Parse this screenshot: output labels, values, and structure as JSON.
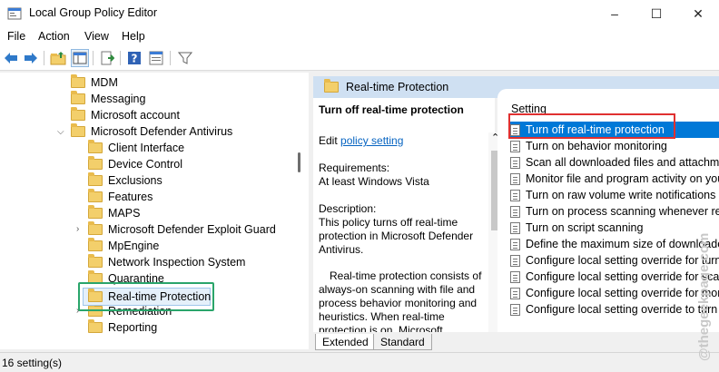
{
  "window": {
    "title": "Local Group Policy Editor",
    "icon": "gpedit-icon",
    "controls": {
      "minimize": "–",
      "maximize": "☐",
      "close": "✕"
    }
  },
  "menu": [
    "File",
    "Action",
    "View",
    "Help"
  ],
  "toolbar": {
    "icons": [
      "back-icon",
      "forward-icon",
      "up-folder-icon",
      "show-hide-tree-icon",
      "export-list-icon",
      "help-icon",
      "properties-icon",
      "filter-icon"
    ]
  },
  "tree": {
    "items": [
      {
        "label": "MDM"
      },
      {
        "label": "Messaging"
      },
      {
        "label": "Microsoft account"
      },
      {
        "label": "Microsoft Defender Antivirus",
        "expanded": true
      },
      {
        "label": "Client Interface"
      },
      {
        "label": "Device Control"
      },
      {
        "label": "Exclusions"
      },
      {
        "label": "Features"
      },
      {
        "label": "MAPS"
      },
      {
        "label": "Microsoft Defender Exploit Guard",
        "collapsed": true
      },
      {
        "label": "MpEngine"
      },
      {
        "label": "Network Inspection System"
      },
      {
        "label": "Quarantine"
      },
      {
        "label": "Real-time Protection",
        "selected": true
      },
      {
        "label": "Remediation",
        "collapsed": true
      },
      {
        "label": "Reporting"
      }
    ]
  },
  "details": {
    "header": "Real-time Protection",
    "policy_title": "Turn off real-time protection",
    "edit_prefix": "Edit",
    "edit_link": "policy setting",
    "requirements_label": "Requirements:",
    "requirements_value": "At least Windows Vista",
    "description_label": "Description:",
    "description_1": "This policy turns off real-time protection in Microsoft Defender Antivirus.",
    "description_2": "Real-time protection consists of always-on scanning with file and process behavior monitoring and heuristics. When real-time protection is on, Microsoft"
  },
  "list": {
    "column": "Setting",
    "rows": [
      "Turn off real-time protection",
      "Turn on behavior monitoring",
      "Scan all downloaded files and attachments",
      "Monitor file and program activity on your computer",
      "Turn on raw volume write notifications",
      "Turn on process scanning whenever real-time protection is enabled",
      "Turn on script scanning",
      "Define the maximum size of downloaded files and attachments to be scanned",
      "Configure local setting override for turn on behavior monitoring",
      "Configure local setting override for scanning all downloaded files",
      "Configure local setting override for monitoring file and program activity",
      "Configure local setting override to turn on real-time protection"
    ],
    "selected_index": 0
  },
  "tabs": [
    "Extended",
    "Standard"
  ],
  "status": "16 setting(s)",
  "watermark": "@thegeekpage.com",
  "colors": {
    "selection": "#0078d7",
    "highlight_red": "#e03030",
    "highlight_green": "#2aa56b",
    "header_bg": "#cfe0f2"
  }
}
